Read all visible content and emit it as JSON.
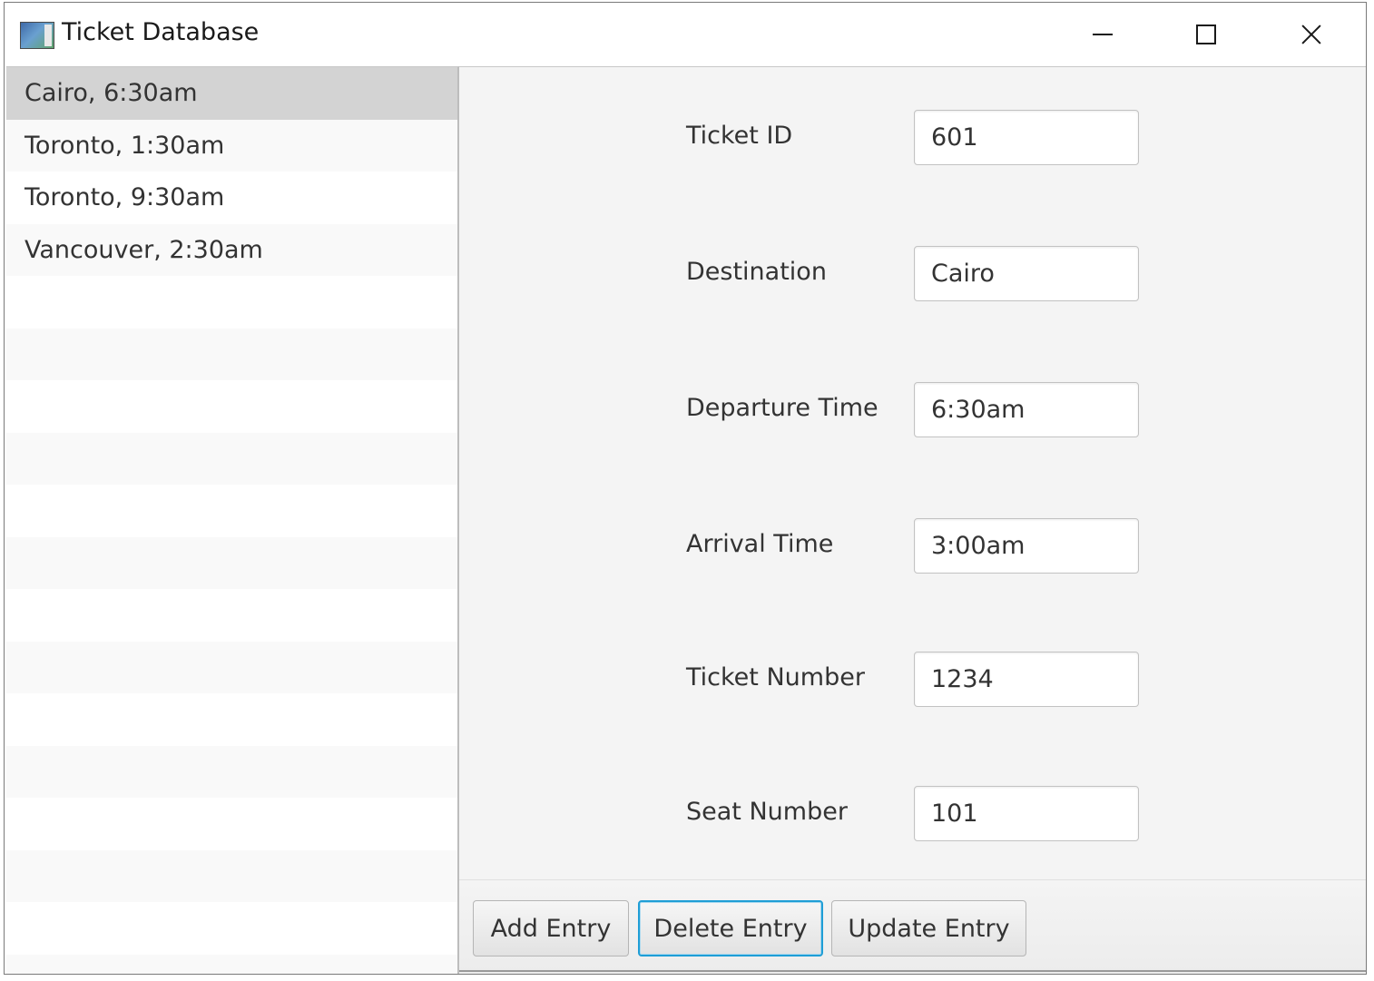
{
  "window": {
    "title": "Ticket Database",
    "icon": "app-table-icon",
    "controls": [
      "minimize-icon",
      "maximize-icon",
      "close-icon"
    ]
  },
  "list": {
    "items": [
      {
        "label": "Cairo, 6:30am",
        "selected": true
      },
      {
        "label": "Toronto, 1:30am",
        "selected": false
      },
      {
        "label": "Toronto, 9:30am",
        "selected": false
      },
      {
        "label": "Vancouver, 2:30am",
        "selected": false
      }
    ]
  },
  "form": {
    "ticket_id": {
      "label": "Ticket ID",
      "value": "601"
    },
    "destination": {
      "label": "Destination",
      "value": "Cairo"
    },
    "departure_time": {
      "label": "Departure Time",
      "value": "6:30am"
    },
    "arrival_time": {
      "label": "Arrival Time",
      "value": "3:00am"
    },
    "ticket_number": {
      "label": "Ticket Number",
      "value": "1234"
    },
    "seat_number": {
      "label": "Seat Number",
      "value": "101"
    }
  },
  "buttons": {
    "add": "Add Entry",
    "delete": "Delete Entry",
    "update": "Update Entry"
  },
  "colors": {
    "selection": "#d3d3d3",
    "focus_ring": "#1f9ed6",
    "pane_background": "#f4f4f4"
  }
}
